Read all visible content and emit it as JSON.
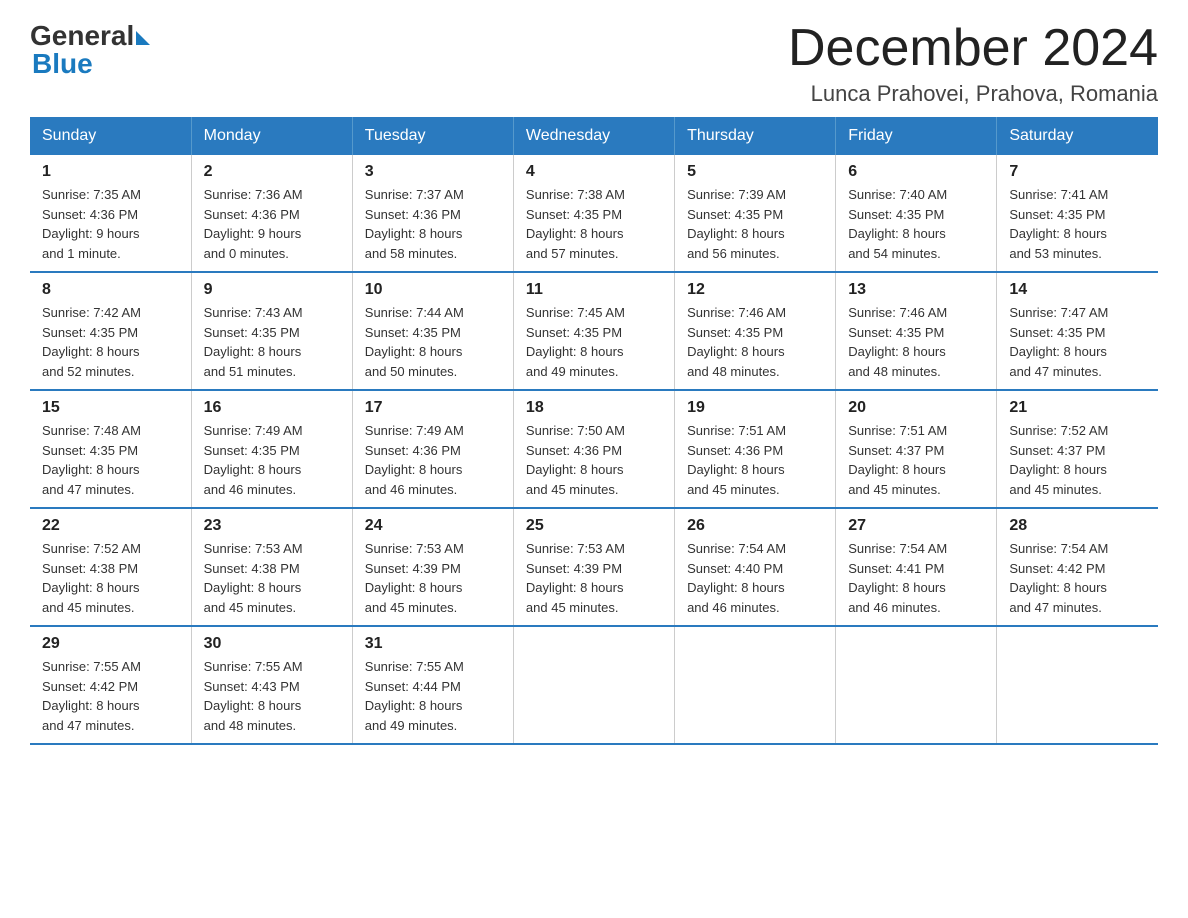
{
  "logo": {
    "general": "General",
    "blue": "Blue"
  },
  "title": "December 2024",
  "subtitle": "Lunca Prahovei, Prahova, Romania",
  "headers": [
    "Sunday",
    "Monday",
    "Tuesday",
    "Wednesday",
    "Thursday",
    "Friday",
    "Saturday"
  ],
  "weeks": [
    [
      {
        "day": "1",
        "info": "Sunrise: 7:35 AM\nSunset: 4:36 PM\nDaylight: 9 hours\nand 1 minute."
      },
      {
        "day": "2",
        "info": "Sunrise: 7:36 AM\nSunset: 4:36 PM\nDaylight: 9 hours\nand 0 minutes."
      },
      {
        "day": "3",
        "info": "Sunrise: 7:37 AM\nSunset: 4:36 PM\nDaylight: 8 hours\nand 58 minutes."
      },
      {
        "day": "4",
        "info": "Sunrise: 7:38 AM\nSunset: 4:35 PM\nDaylight: 8 hours\nand 57 minutes."
      },
      {
        "day": "5",
        "info": "Sunrise: 7:39 AM\nSunset: 4:35 PM\nDaylight: 8 hours\nand 56 minutes."
      },
      {
        "day": "6",
        "info": "Sunrise: 7:40 AM\nSunset: 4:35 PM\nDaylight: 8 hours\nand 54 minutes."
      },
      {
        "day": "7",
        "info": "Sunrise: 7:41 AM\nSunset: 4:35 PM\nDaylight: 8 hours\nand 53 minutes."
      }
    ],
    [
      {
        "day": "8",
        "info": "Sunrise: 7:42 AM\nSunset: 4:35 PM\nDaylight: 8 hours\nand 52 minutes."
      },
      {
        "day": "9",
        "info": "Sunrise: 7:43 AM\nSunset: 4:35 PM\nDaylight: 8 hours\nand 51 minutes."
      },
      {
        "day": "10",
        "info": "Sunrise: 7:44 AM\nSunset: 4:35 PM\nDaylight: 8 hours\nand 50 minutes."
      },
      {
        "day": "11",
        "info": "Sunrise: 7:45 AM\nSunset: 4:35 PM\nDaylight: 8 hours\nand 49 minutes."
      },
      {
        "day": "12",
        "info": "Sunrise: 7:46 AM\nSunset: 4:35 PM\nDaylight: 8 hours\nand 48 minutes."
      },
      {
        "day": "13",
        "info": "Sunrise: 7:46 AM\nSunset: 4:35 PM\nDaylight: 8 hours\nand 48 minutes."
      },
      {
        "day": "14",
        "info": "Sunrise: 7:47 AM\nSunset: 4:35 PM\nDaylight: 8 hours\nand 47 minutes."
      }
    ],
    [
      {
        "day": "15",
        "info": "Sunrise: 7:48 AM\nSunset: 4:35 PM\nDaylight: 8 hours\nand 47 minutes."
      },
      {
        "day": "16",
        "info": "Sunrise: 7:49 AM\nSunset: 4:35 PM\nDaylight: 8 hours\nand 46 minutes."
      },
      {
        "day": "17",
        "info": "Sunrise: 7:49 AM\nSunset: 4:36 PM\nDaylight: 8 hours\nand 46 minutes."
      },
      {
        "day": "18",
        "info": "Sunrise: 7:50 AM\nSunset: 4:36 PM\nDaylight: 8 hours\nand 45 minutes."
      },
      {
        "day": "19",
        "info": "Sunrise: 7:51 AM\nSunset: 4:36 PM\nDaylight: 8 hours\nand 45 minutes."
      },
      {
        "day": "20",
        "info": "Sunrise: 7:51 AM\nSunset: 4:37 PM\nDaylight: 8 hours\nand 45 minutes."
      },
      {
        "day": "21",
        "info": "Sunrise: 7:52 AM\nSunset: 4:37 PM\nDaylight: 8 hours\nand 45 minutes."
      }
    ],
    [
      {
        "day": "22",
        "info": "Sunrise: 7:52 AM\nSunset: 4:38 PM\nDaylight: 8 hours\nand 45 minutes."
      },
      {
        "day": "23",
        "info": "Sunrise: 7:53 AM\nSunset: 4:38 PM\nDaylight: 8 hours\nand 45 minutes."
      },
      {
        "day": "24",
        "info": "Sunrise: 7:53 AM\nSunset: 4:39 PM\nDaylight: 8 hours\nand 45 minutes."
      },
      {
        "day": "25",
        "info": "Sunrise: 7:53 AM\nSunset: 4:39 PM\nDaylight: 8 hours\nand 45 minutes."
      },
      {
        "day": "26",
        "info": "Sunrise: 7:54 AM\nSunset: 4:40 PM\nDaylight: 8 hours\nand 46 minutes."
      },
      {
        "day": "27",
        "info": "Sunrise: 7:54 AM\nSunset: 4:41 PM\nDaylight: 8 hours\nand 46 minutes."
      },
      {
        "day": "28",
        "info": "Sunrise: 7:54 AM\nSunset: 4:42 PM\nDaylight: 8 hours\nand 47 minutes."
      }
    ],
    [
      {
        "day": "29",
        "info": "Sunrise: 7:55 AM\nSunset: 4:42 PM\nDaylight: 8 hours\nand 47 minutes."
      },
      {
        "day": "30",
        "info": "Sunrise: 7:55 AM\nSunset: 4:43 PM\nDaylight: 8 hours\nand 48 minutes."
      },
      {
        "day": "31",
        "info": "Sunrise: 7:55 AM\nSunset: 4:44 PM\nDaylight: 8 hours\nand 49 minutes."
      },
      {
        "day": "",
        "info": ""
      },
      {
        "day": "",
        "info": ""
      },
      {
        "day": "",
        "info": ""
      },
      {
        "day": "",
        "info": ""
      }
    ]
  ]
}
